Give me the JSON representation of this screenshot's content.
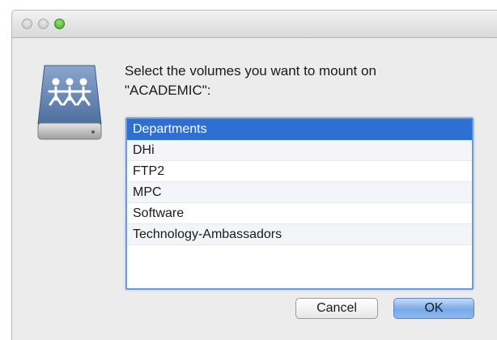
{
  "dialog": {
    "prompt": "Select the volumes you want to mount on\n\"ACADEMIC\":",
    "icon": "network-share-drive-icon"
  },
  "volumes": [
    {
      "label": "Departments",
      "selected": true
    },
    {
      "label": "DHi",
      "selected": false
    },
    {
      "label": "FTP2",
      "selected": false
    },
    {
      "label": "MPC",
      "selected": false
    },
    {
      "label": "Software",
      "selected": false
    },
    {
      "label": "Technology-Ambassadors",
      "selected": false
    }
  ],
  "buttons": {
    "cancel": "Cancel",
    "ok": "OK"
  },
  "colors": {
    "selection": "#2f6fd3",
    "default_button": "#77a8e8",
    "zoom_light": "#3fa823"
  }
}
